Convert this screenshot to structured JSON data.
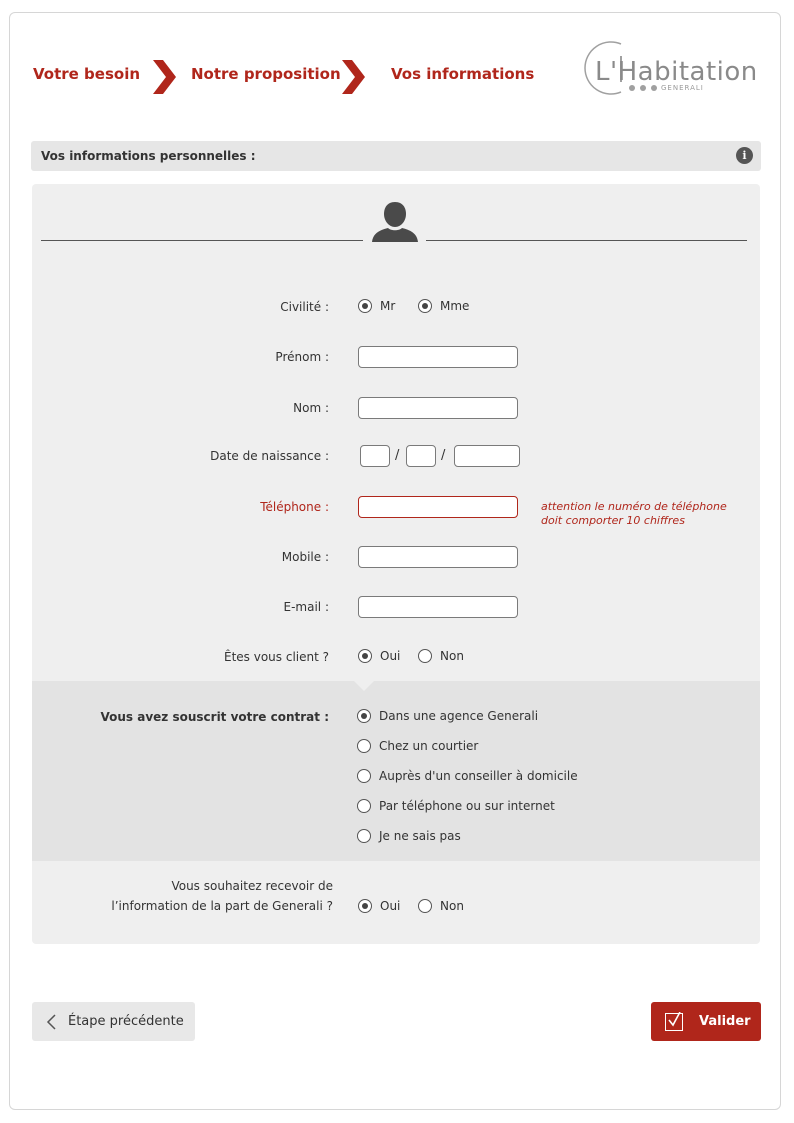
{
  "steps": [
    {
      "label": "Votre besoin"
    },
    {
      "label": "Notre proposition"
    },
    {
      "label": "Vos informations"
    }
  ],
  "logo": {
    "text": "L'Habitation",
    "sub": "GENERALI"
  },
  "section": {
    "title": "Vos informations personnelles :",
    "info_icon": "i"
  },
  "form": {
    "civilite": {
      "label": "Civilité :",
      "options": [
        "Mr",
        "Mme"
      ],
      "selected": [
        "Mr",
        "Mme"
      ]
    },
    "prenom": {
      "label": "Prénom :",
      "value": ""
    },
    "nom": {
      "label": "Nom :",
      "value": ""
    },
    "naissance": {
      "label": "Date de naissance :",
      "sep": "/"
    },
    "telephone": {
      "label": "Téléphone :",
      "value": "",
      "error_line1": "attention le numéro de téléphone",
      "error_line2": "doit comporter 10 chiffres"
    },
    "mobile": {
      "label": "Mobile :",
      "value": ""
    },
    "email": {
      "label": "E-mail :",
      "value": ""
    },
    "client": {
      "label": "Êtes vous client ?",
      "options": [
        "Oui",
        "Non"
      ],
      "selected": "Oui"
    },
    "contrat": {
      "label": "Vous avez souscrit votre contrat :",
      "options": [
        "Dans une agence Generali",
        "Chez un courtier",
        "Auprès d'un conseiller à domicile",
        "Par téléphone ou sur internet",
        "Je ne sais pas"
      ],
      "selected": "Dans une agence Generali"
    },
    "information": {
      "label_line1": "Vous souhaitez recevoir de",
      "label_line2": "l’information de la part de Generali ?",
      "options": [
        "Oui",
        "Non"
      ],
      "selected": "Oui"
    }
  },
  "buttons": {
    "previous": "Étape précédente",
    "submit": "Valider"
  },
  "colors": {
    "accent": "#b0261b",
    "panel": "#efefef",
    "band": "#e3e3e3"
  }
}
